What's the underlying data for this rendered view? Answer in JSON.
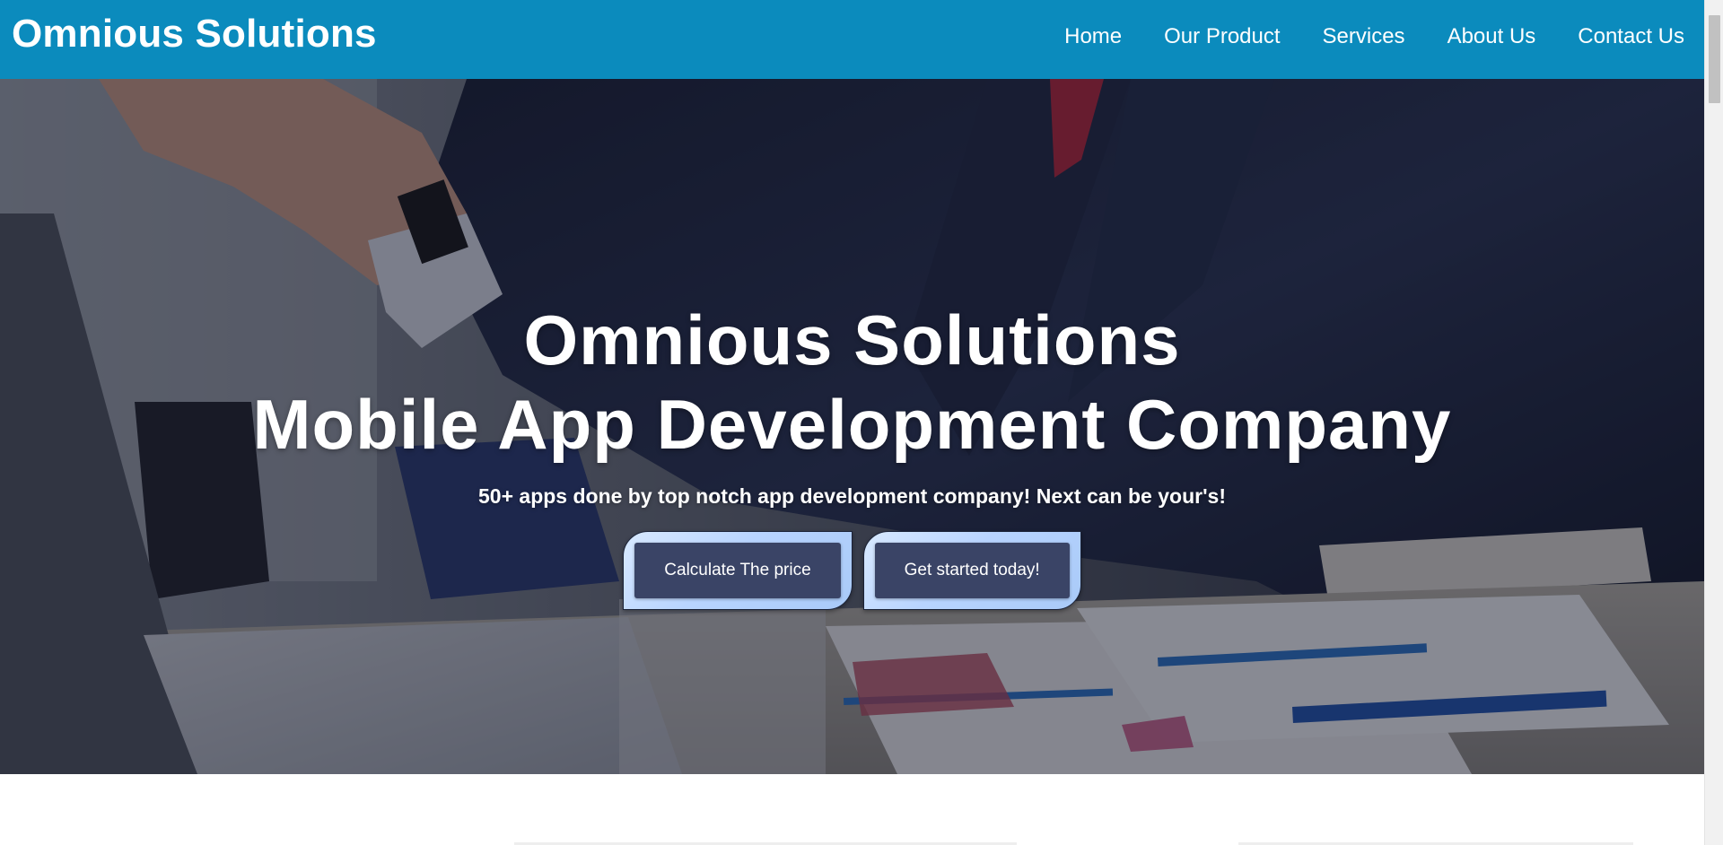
{
  "header": {
    "brand": "Omnious Solutions",
    "nav": [
      "Home",
      "Our Product",
      "Services",
      "About Us",
      "Contact Us"
    ]
  },
  "hero": {
    "title_line1": "Omnious Solutions",
    "title_line2": "Mobile App Development Company",
    "subtitle": "50+ apps done by top notch app development company! Next can be your's!",
    "buttons": {
      "calculate": "Calculate The price",
      "get_started": "Get started today!"
    },
    "background": "office-businessman-photo"
  },
  "colors": {
    "header_bg": "#0b8bbd",
    "button_bg": "#3a4466",
    "button_frame": "#b8d4ff"
  }
}
